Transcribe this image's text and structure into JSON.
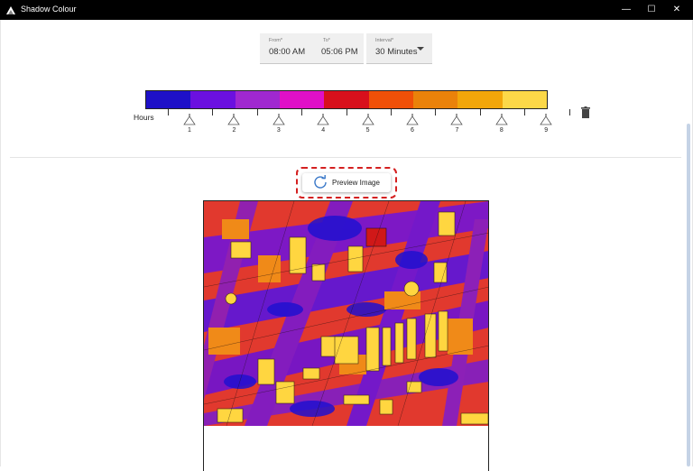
{
  "window": {
    "title": "Shadow Colour",
    "minimize": "—",
    "maximize": "☐",
    "close": "✕"
  },
  "fields": {
    "from": {
      "label": "From*",
      "value": "08:00 AM"
    },
    "to": {
      "label": "To*",
      "value": "05:06 PM"
    },
    "interval": {
      "label": "Interval*",
      "value": "30 Minutes"
    }
  },
  "legend": {
    "label": "Hours",
    "colors": [
      "#1e10c8",
      "#6b10e0",
      "#a028d0",
      "#e010c8",
      "#d8101c",
      "#f05008",
      "#ea820a",
      "#f2a60a",
      "#fcd848"
    ],
    "ticks": [
      "1",
      "2",
      "3",
      "4",
      "5",
      "6",
      "7",
      "8",
      "9"
    ]
  },
  "preview": {
    "label": "Preview Image"
  },
  "icons": {
    "app": "app-icon",
    "refresh": "refresh-icon",
    "trash": "trash-icon"
  }
}
